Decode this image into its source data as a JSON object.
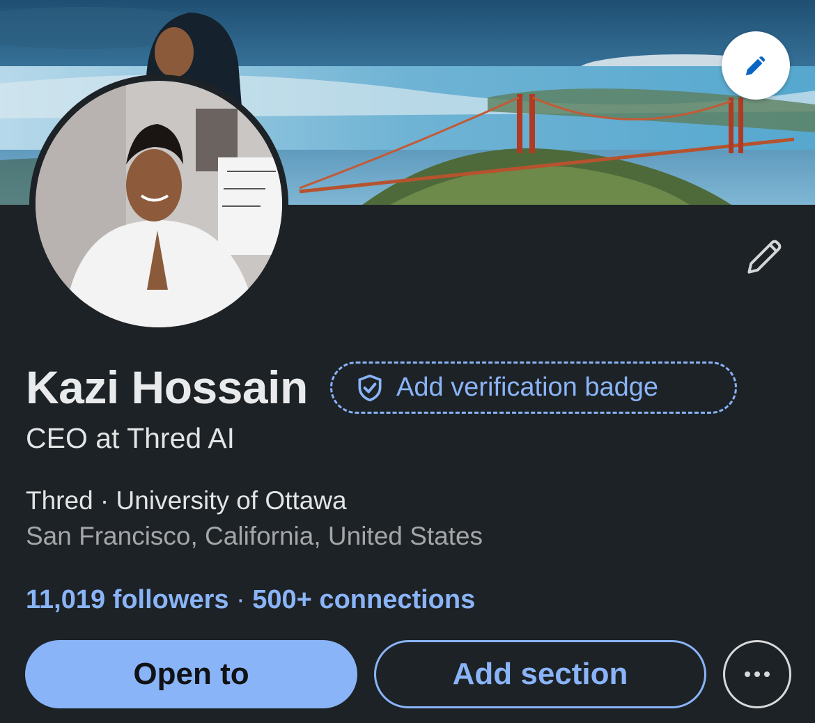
{
  "profile": {
    "name": "Kazi Hossain",
    "verification_badge_label": "Add verification badge",
    "headline": "CEO at Thred AI",
    "company": "Thred",
    "school": "University of Ottawa",
    "education_separator": " · ",
    "location": "San Francisco, California, United States",
    "followers": "11,019 followers",
    "network_separator": " · ",
    "connections": "500+ connections"
  },
  "actions": {
    "open_to_label": "Open to",
    "add_section_label": "Add section"
  },
  "icons": {
    "cover_edit": "pencil-icon",
    "intro_edit": "pencil-outline-icon",
    "verify": "shield-check-icon",
    "more": "ellipsis-icon"
  },
  "colors": {
    "background": "#1d2226",
    "accent": "#8ab4f8",
    "primary_text": "#e9eaeb",
    "secondary_text": "#a4a6a8"
  }
}
